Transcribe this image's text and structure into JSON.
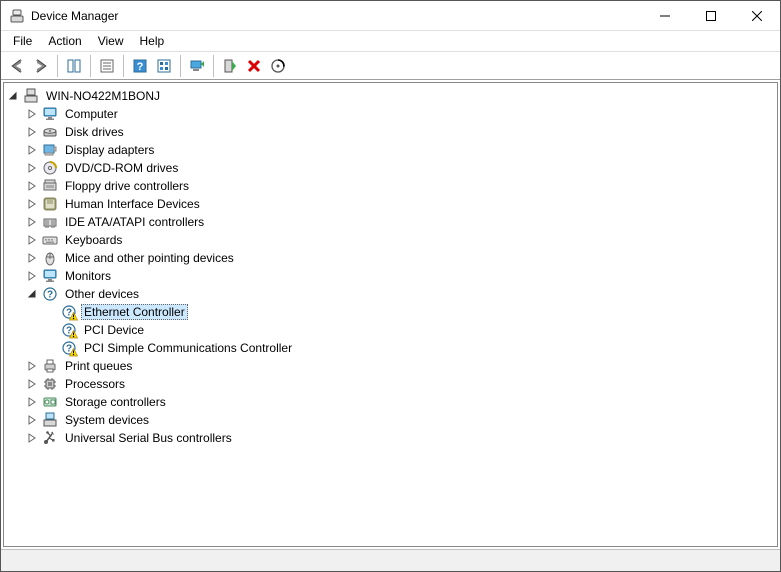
{
  "window": {
    "title": "Device Manager"
  },
  "menu": {
    "items": [
      "File",
      "Action",
      "View",
      "Help"
    ]
  },
  "toolbar": {
    "buttons": [
      {
        "id": "back",
        "icon": "arrow-left",
        "enabled": true
      },
      {
        "id": "forward",
        "icon": "arrow-right",
        "enabled": true
      },
      {
        "sep": true
      },
      {
        "id": "show-hide-tree",
        "icon": "vsplit",
        "enabled": true
      },
      {
        "sep": true
      },
      {
        "id": "properties",
        "icon": "properties",
        "enabled": true
      },
      {
        "sep": true
      },
      {
        "id": "help",
        "icon": "help",
        "enabled": true
      },
      {
        "id": "options",
        "icon": "options",
        "enabled": true
      },
      {
        "sep": true
      },
      {
        "id": "update-driver",
        "icon": "update-driver",
        "enabled": true
      },
      {
        "sep": true
      },
      {
        "id": "enable",
        "icon": "enable",
        "enabled": true
      },
      {
        "id": "uninstall",
        "icon": "uninstall",
        "enabled": true
      },
      {
        "id": "scan-hardware",
        "icon": "scan-hardware",
        "enabled": true
      }
    ]
  },
  "tree": {
    "root": {
      "label": "WIN-NO422M1BONJ",
      "icon": "computer-root",
      "state": "expanded",
      "children": [
        {
          "label": "Computer",
          "icon": "monitor",
          "state": "collapsed"
        },
        {
          "label": "Disk drives",
          "icon": "disk",
          "state": "collapsed"
        },
        {
          "label": "Display adapters",
          "icon": "display-adapter",
          "state": "collapsed"
        },
        {
          "label": "DVD/CD-ROM drives",
          "icon": "optical",
          "state": "collapsed"
        },
        {
          "label": "Floppy drive controllers",
          "icon": "floppy-ctrl",
          "state": "collapsed"
        },
        {
          "label": "Human Interface Devices",
          "icon": "hid",
          "state": "collapsed"
        },
        {
          "label": "IDE ATA/ATAPI controllers",
          "icon": "ide",
          "state": "collapsed"
        },
        {
          "label": "Keyboards",
          "icon": "keyboard",
          "state": "collapsed"
        },
        {
          "label": "Mice and other pointing devices",
          "icon": "mouse",
          "state": "collapsed"
        },
        {
          "label": "Monitors",
          "icon": "monitor",
          "state": "collapsed"
        },
        {
          "label": "Other devices",
          "icon": "unknown",
          "state": "expanded",
          "children": [
            {
              "label": "Ethernet Controller",
              "icon": "unknown-warn",
              "state": "leaf",
              "selected": true
            },
            {
              "label": "PCI Device",
              "icon": "unknown-warn",
              "state": "leaf"
            },
            {
              "label": "PCI Simple Communications Controller",
              "icon": "unknown-warn",
              "state": "leaf"
            }
          ]
        },
        {
          "label": "Print queues",
          "icon": "printer",
          "state": "collapsed"
        },
        {
          "label": "Processors",
          "icon": "processor",
          "state": "collapsed"
        },
        {
          "label": "Storage controllers",
          "icon": "storage",
          "state": "collapsed"
        },
        {
          "label": "System devices",
          "icon": "system",
          "state": "collapsed"
        },
        {
          "label": "Universal Serial Bus controllers",
          "icon": "usb",
          "state": "collapsed"
        }
      ]
    }
  },
  "statusbar": {
    "text": ""
  }
}
